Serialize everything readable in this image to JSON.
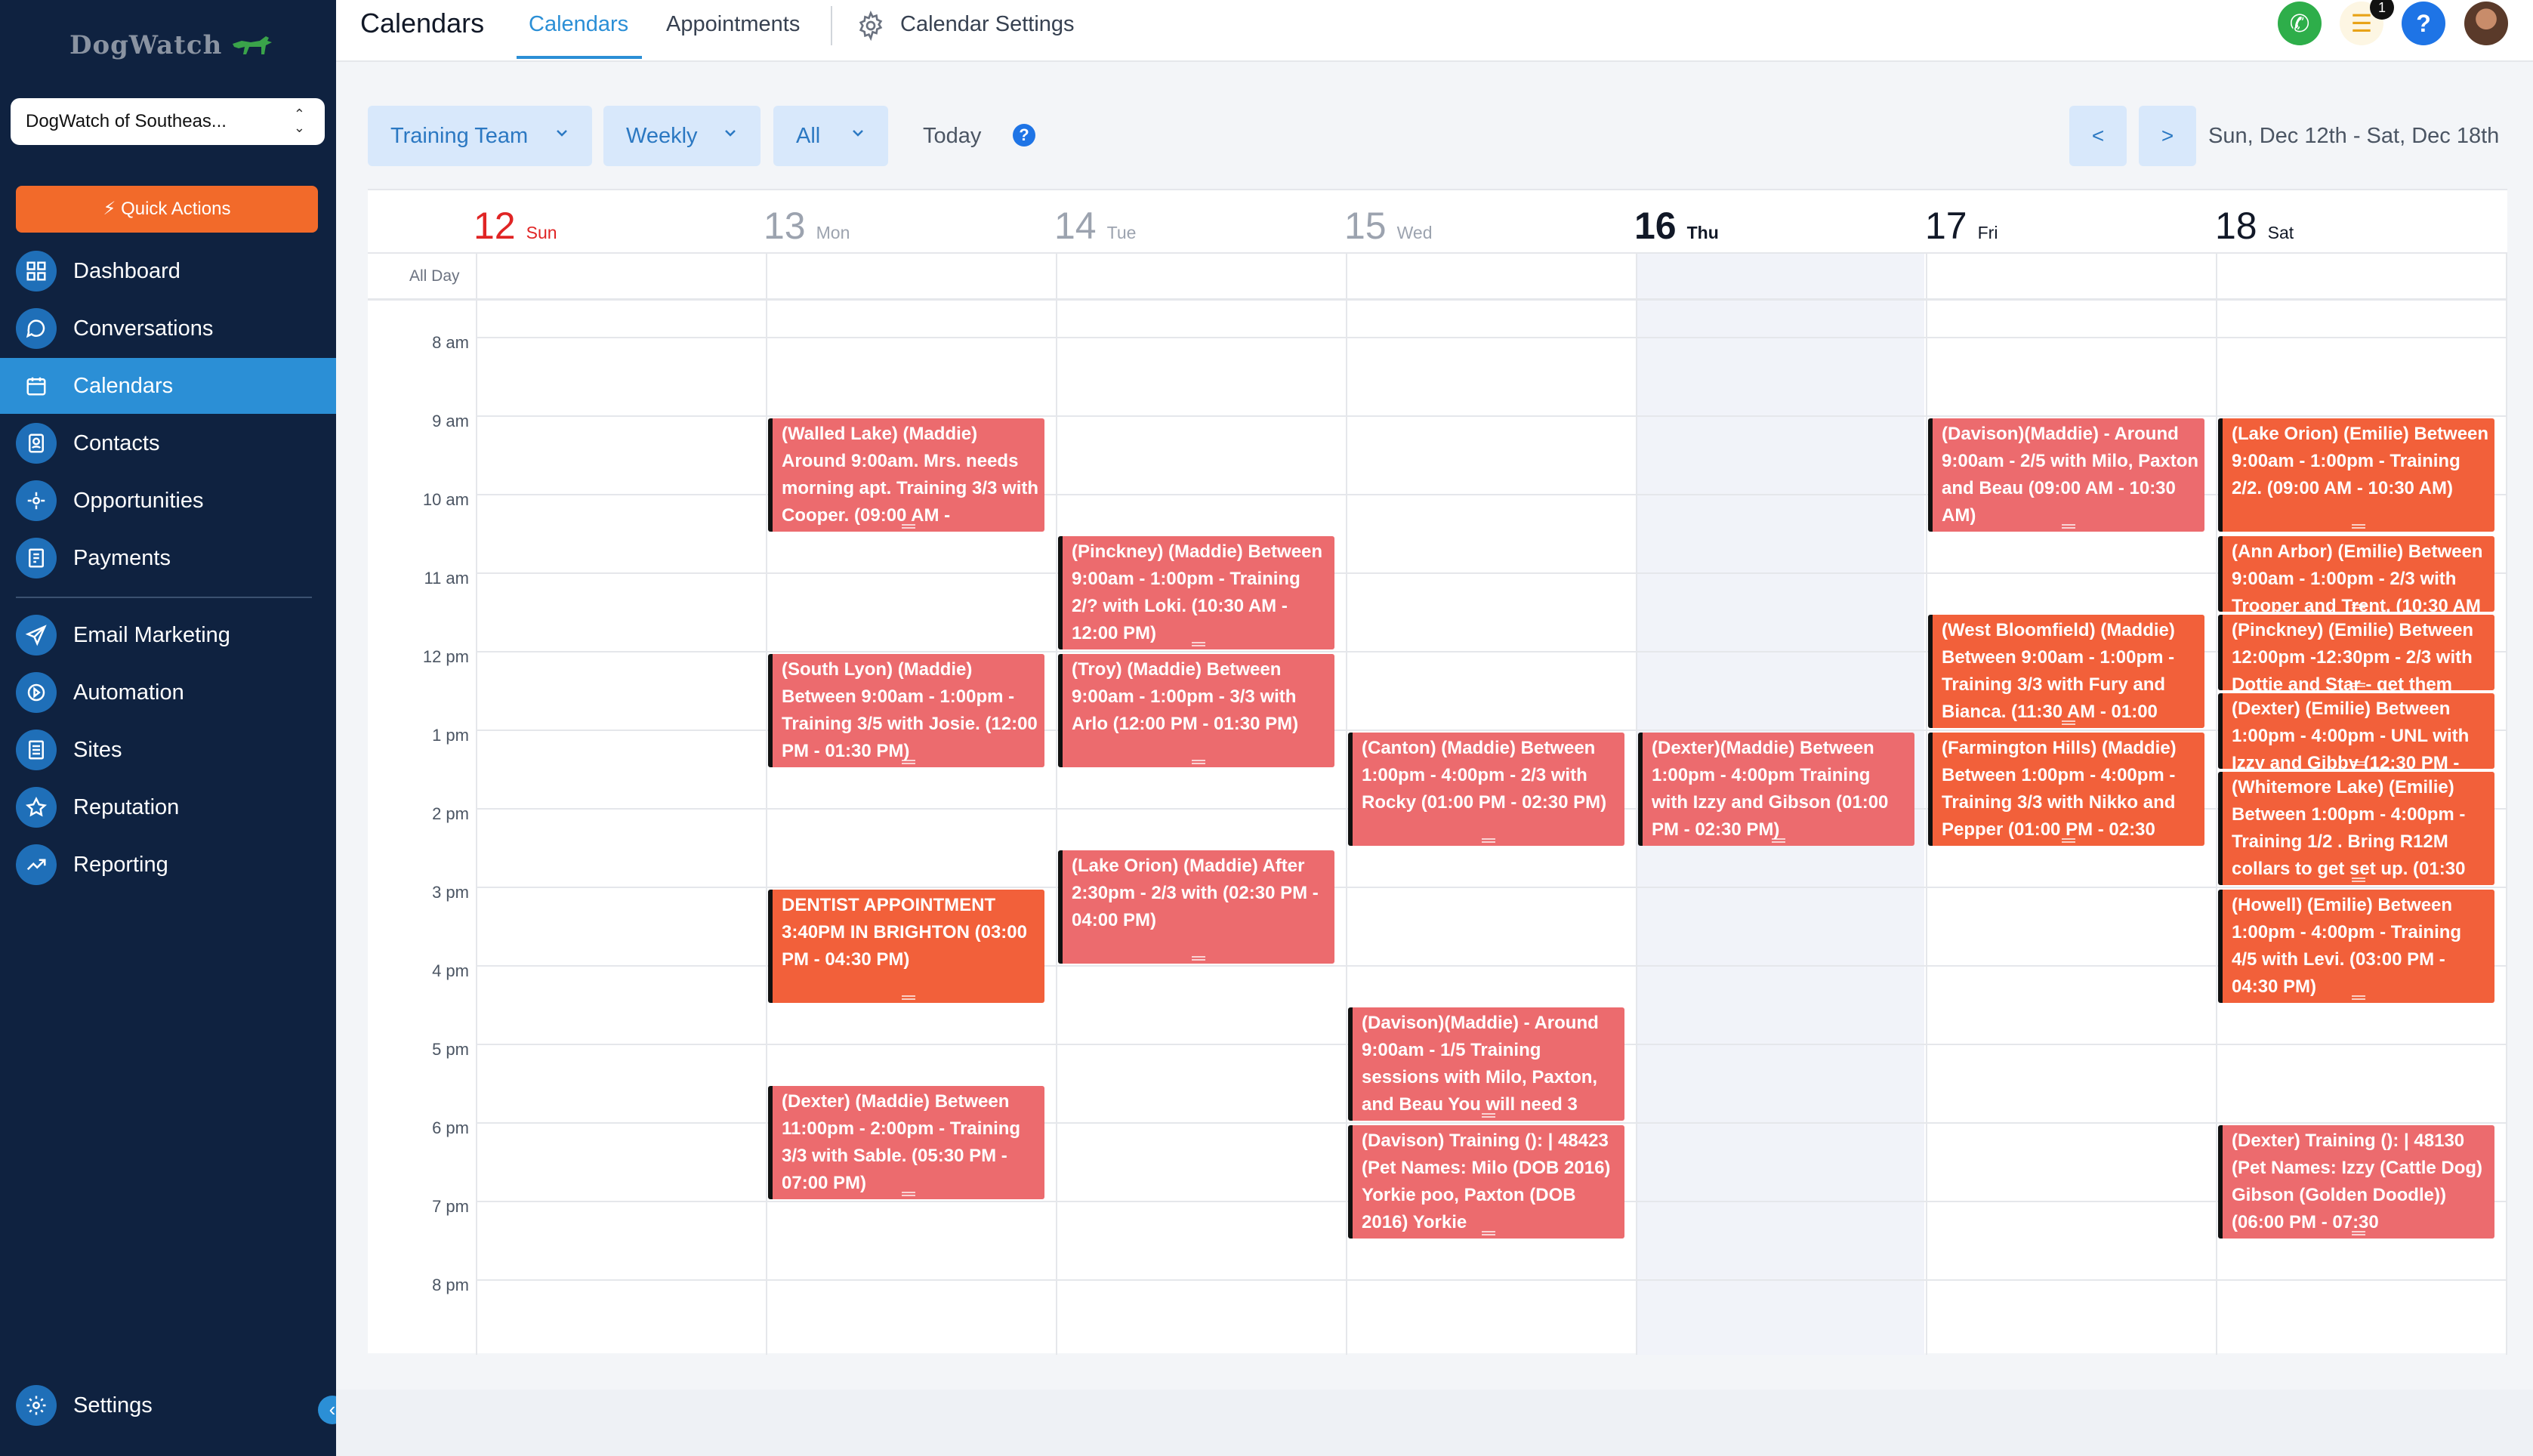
{
  "sidebar": {
    "logo_text": "DogWatch",
    "location": "DogWatch of Southeas...",
    "quick_actions": "Quick Actions",
    "items": [
      {
        "label": "Dashboard",
        "icon": "dashboard-icon"
      },
      {
        "label": "Conversations",
        "icon": "chat-icon"
      },
      {
        "label": "Calendars",
        "icon": "calendar-icon",
        "active": true
      },
      {
        "label": "Contacts",
        "icon": "contacts-icon"
      },
      {
        "label": "Opportunities",
        "icon": "opportunities-icon"
      },
      {
        "label": "Payments",
        "icon": "payments-icon"
      },
      {
        "label": "Email Marketing",
        "icon": "send-icon"
      },
      {
        "label": "Automation",
        "icon": "automation-icon"
      },
      {
        "label": "Sites",
        "icon": "sites-icon"
      },
      {
        "label": "Reputation",
        "icon": "star-icon"
      },
      {
        "label": "Reporting",
        "icon": "trend-icon"
      }
    ],
    "settings": "Settings",
    "collapse": "‹"
  },
  "header": {
    "title": "Calendars",
    "tabs": [
      "Calendars",
      "Appointments",
      "Calendar Settings"
    ],
    "active_tab": "Calendars",
    "task_count": "1",
    "help": "?"
  },
  "toolbar": {
    "team": "Training Team",
    "view": "Weekly",
    "filter": "All",
    "today": "Today",
    "prev": "<",
    "next": ">",
    "range": "Sun, Dec 12th - Sat, Dec 18th"
  },
  "calendar": {
    "all_day_label": "All Day",
    "days": [
      {
        "num": "12",
        "name": "Sun"
      },
      {
        "num": "13",
        "name": "Mon"
      },
      {
        "num": "14",
        "name": "Tue"
      },
      {
        "num": "15",
        "name": "Wed"
      },
      {
        "num": "16",
        "name": "Thu"
      },
      {
        "num": "17",
        "name": "Fri"
      },
      {
        "num": "18",
        "name": "Sat"
      }
    ],
    "hours": [
      "8 am",
      "9 am",
      "10 am",
      "11 am",
      "12 pm",
      "1 pm",
      "2 pm",
      "3 pm",
      "4 pm",
      "5 pm",
      "6 pm",
      "7 pm",
      "8 pm"
    ],
    "events": [
      {
        "text": "(Walled Lake) (Maddie) Around 9:00am. Mrs. needs morning apt. Training 3/3 with Cooper. (09:00 AM -"
      },
      {
        "text": "(South Lyon) (Maddie) Between 9:00am - 1:00pm - Training 3/5 with Josie. (12:00 PM - 01:30 PM)"
      },
      {
        "text": "DENTIST APPOINTMENT 3:40PM IN BRIGHTON (03:00 PM - 04:30 PM)"
      },
      {
        "text": "(Dexter) (Maddie) Between 11:00pm - 2:00pm - Training 3/3 with Sable. (05:30 PM - 07:00 PM)"
      },
      {
        "text": "(Pinckney) (Maddie) Between 9:00am - 1:00pm - Training 2/? with Loki. (10:30 AM - 12:00 PM)"
      },
      {
        "text": "(Troy) (Maddie) Between 9:00am - 1:00pm - 3/3 with Arlo (12:00 PM - 01:30 PM)"
      },
      {
        "text": "(Lake Orion) (Maddie) After 2:30pm - 2/3 with (02:30 PM - 04:00 PM)"
      },
      {
        "text": "(Canton) (Maddie) Between 1:00pm - 4:00pm - 2/3 with Rocky (01:00 PM - 02:30 PM)"
      },
      {
        "text": "(Davison)(Maddie) - Around 9:00am - 1/5 Training sessions with Milo, Paxton, and Beau You will need 3"
      },
      {
        "text": "(Davison) Training (): |  48423 (Pet Names: Milo (DOB 2016) Yorkie poo, Paxton (DOB 2016) Yorkie"
      },
      {
        "text": "(Dexter)(Maddie) Between 1:00pm - 4:00pm Training with Izzy and Gibson (01:00 PM - 02:30 PM)"
      },
      {
        "text": "(Davison)(Maddie) - Around 9:00am - 2/5 with Milo, Paxton and Beau (09:00 AM - 10:30 AM)"
      },
      {
        "text": "(West Bloomfield) (Maddie) Between 9:00am - 1:00pm - Training 3/3 with Fury and Bianca. (11:30 AM - 01:00"
      },
      {
        "text": "(Farmington Hills) (Maddie) Between 1:00pm - 4:00pm - Training 3/3 with Nikko and Pepper (01:00 PM - 02:30"
      },
      {
        "text": "(Lake Orion) (Emilie) Between 9:00am - 1:00pm - Training 2/2. (09:00 AM - 10:30 AM)"
      },
      {
        "text": "(Ann Arbor) (Emilie) Between 9:00am - 1:00pm - 2/3 with Trooper and Trent. (10:30 AM"
      },
      {
        "text": "(Pinckney) (Emilie) Between 12:00pm -12:30pm - 2/3 with Dottie and Star - get them"
      },
      {
        "text": "(Dexter) (Emilie) Between 1:00pm - 4:00pm - UNL with Izzy and Gibby (12:30 PM -"
      },
      {
        "text": "(Whitemore Lake) (Emilie) Between 1:00pm - 4:00pm - Training 1/2 . Bring R12M collars to get set up. (01:30"
      },
      {
        "text": "(Howell) (Emilie) Between 1:00pm - 4:00pm - Training 4/5 with Levi. (03:00 PM - 04:30 PM)"
      },
      {
        "text": "(Dexter) Training (): |  48130 (Pet Names: Izzy (Cattle Dog) Gibson (Golden Doodle)) (06:00 PM - 07:30"
      }
    ]
  },
  "colors": {
    "sidebar_bg": "#0f2240",
    "accent": "#2b8fd6",
    "event_red": "#ec6b6e",
    "event_orange": "#f2603a",
    "quick_actions": "#f26a2a"
  }
}
